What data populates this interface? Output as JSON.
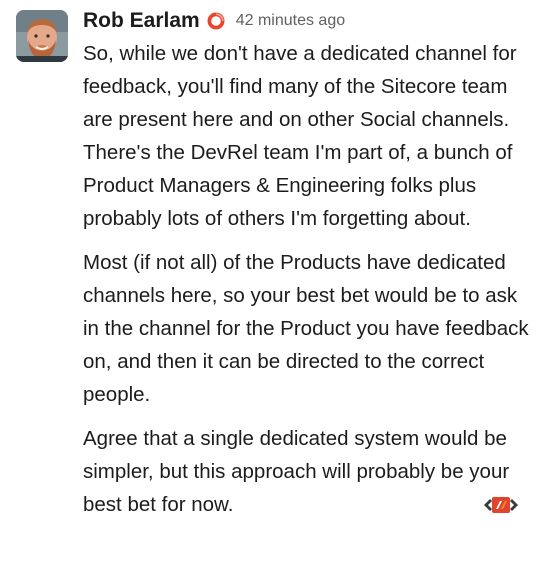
{
  "message": {
    "author": "Rob Earlam",
    "status_icon": "red-ring-status-icon",
    "timestamp": "42 minutes ago",
    "paragraphs": [
      "So, while we don't have a dedicated channel for feedback, you'll find many of the Sitecore team are present here and on other Social channels. There's the DevRel team I'm part of, a bunch of Product Managers & Engineering folks plus probably lots of others I'm forgetting about.",
      "Most (if not all) of the Products have dedicated channels here, so your best bet would be to ask in the channel for the Product you have feedback on, and then it can be directed to the correct people.",
      "Agree that a single dedicated system would be simpler, but this approach will probably be your best bet for now."
    ]
  },
  "colors": {
    "status_ring": "#e8442e",
    "overlay_icon_red": "#e0442c",
    "overlay_icon_orange": "#f08a24",
    "text": "#1d1c1d",
    "timestamp": "#616061"
  },
  "overlay": {
    "icon": "sitecore-code-icon"
  }
}
